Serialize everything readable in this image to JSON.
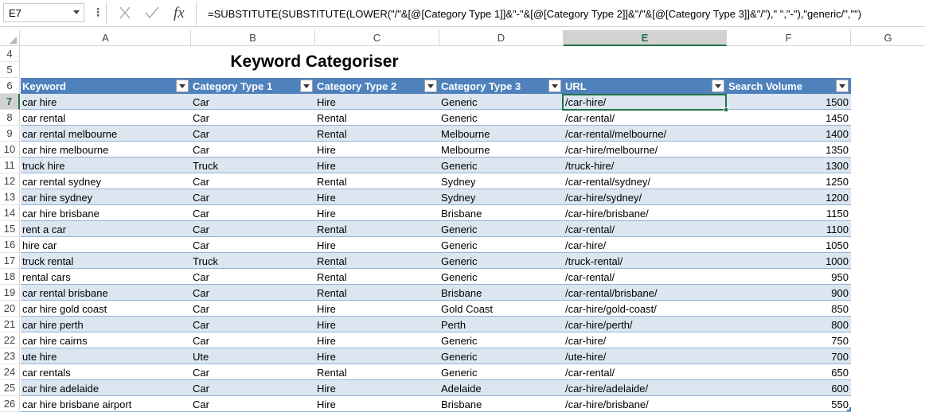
{
  "formula_bar": {
    "name_box": "E7",
    "formula": "=SUBSTITUTE(SUBSTITUTE(LOWER(\"/\"&[@[Category Type 1]]&\"-\"&[@[Category Type 2]]&\"/\"&[@[Category Type 3]]&\"/\"),\" \",\"-\"),\"generic/\",\"\")",
    "icons": [
      "more-options-icon",
      "cancel-icon",
      "enter-icon",
      "insert-function-icon"
    ],
    "fx_label": "fx"
  },
  "columns": [
    "A",
    "B",
    "C",
    "D",
    "E",
    "F",
    "G"
  ],
  "selected_column": "E",
  "selected_row": "7",
  "title": "Keyword Categoriser",
  "header_row_number": "6",
  "title_row_numbers": [
    "4",
    "5"
  ],
  "table": {
    "headers": [
      "Keyword",
      "Category Type 1",
      "Category Type 2",
      "Category Type 3",
      "URL",
      "Search Volume"
    ],
    "rows": [
      {
        "n": "7",
        "cells": [
          "car hire",
          "Car",
          "Hire",
          "Generic",
          "/car-hire/",
          "1500"
        ]
      },
      {
        "n": "8",
        "cells": [
          "car rental",
          "Car",
          "Rental",
          "Generic",
          "/car-rental/",
          "1450"
        ]
      },
      {
        "n": "9",
        "cells": [
          "car rental melbourne",
          "Car",
          "Rental",
          "Melbourne",
          "/car-rental/melbourne/",
          "1400"
        ]
      },
      {
        "n": "10",
        "cells": [
          "car hire melbourne",
          "Car",
          "Hire",
          "Melbourne",
          "/car-hire/melbourne/",
          "1350"
        ]
      },
      {
        "n": "11",
        "cells": [
          "truck hire",
          "Truck",
          "Hire",
          "Generic",
          "/truck-hire/",
          "1300"
        ]
      },
      {
        "n": "12",
        "cells": [
          "car rental sydney",
          "Car",
          "Rental",
          "Sydney",
          "/car-rental/sydney/",
          "1250"
        ]
      },
      {
        "n": "13",
        "cells": [
          "car hire sydney",
          "Car",
          "Hire",
          "Sydney",
          "/car-hire/sydney/",
          "1200"
        ]
      },
      {
        "n": "14",
        "cells": [
          "car hire brisbane",
          "Car",
          "Hire",
          "Brisbane",
          "/car-hire/brisbane/",
          "1150"
        ]
      },
      {
        "n": "15",
        "cells": [
          "rent a car",
          "Car",
          "Rental",
          "Generic",
          "/car-rental/",
          "1100"
        ]
      },
      {
        "n": "16",
        "cells": [
          "hire car",
          "Car",
          "Hire",
          "Generic",
          "/car-hire/",
          "1050"
        ]
      },
      {
        "n": "17",
        "cells": [
          "truck rental",
          "Truck",
          "Rental",
          "Generic",
          "/truck-rental/",
          "1000"
        ]
      },
      {
        "n": "18",
        "cells": [
          "rental cars",
          "Car",
          "Rental",
          "Generic",
          "/car-rental/",
          "950"
        ]
      },
      {
        "n": "19",
        "cells": [
          "car rental brisbane",
          "Car",
          "Rental",
          "Brisbane",
          "/car-rental/brisbane/",
          "900"
        ]
      },
      {
        "n": "20",
        "cells": [
          "car hire gold coast",
          "Car",
          "Hire",
          "Gold Coast",
          "/car-hire/gold-coast/",
          "850"
        ]
      },
      {
        "n": "21",
        "cells": [
          "car hire perth",
          "Car",
          "Hire",
          "Perth",
          "/car-hire/perth/",
          "800"
        ]
      },
      {
        "n": "22",
        "cells": [
          "car hire cairns",
          "Car",
          "Hire",
          "Generic",
          "/car-hire/",
          "750"
        ]
      },
      {
        "n": "23",
        "cells": [
          "ute hire",
          "Ute",
          "Hire",
          "Generic",
          "/ute-hire/",
          "700"
        ]
      },
      {
        "n": "24",
        "cells": [
          "car rentals",
          "Car",
          "Rental",
          "Generic",
          "/car-rental/",
          "650"
        ]
      },
      {
        "n": "25",
        "cells": [
          "car hire adelaide",
          "Car",
          "Hire",
          "Adelaide",
          "/car-hire/adelaide/",
          "600"
        ]
      },
      {
        "n": "26",
        "cells": [
          "car hire brisbane airport",
          "Car",
          "Hire",
          "Brisbane",
          "/car-hire/brisbane/",
          "550"
        ]
      }
    ]
  },
  "colors": {
    "table_header": "#4f81bd",
    "band": "#dce6f1",
    "selection": "#217346"
  }
}
